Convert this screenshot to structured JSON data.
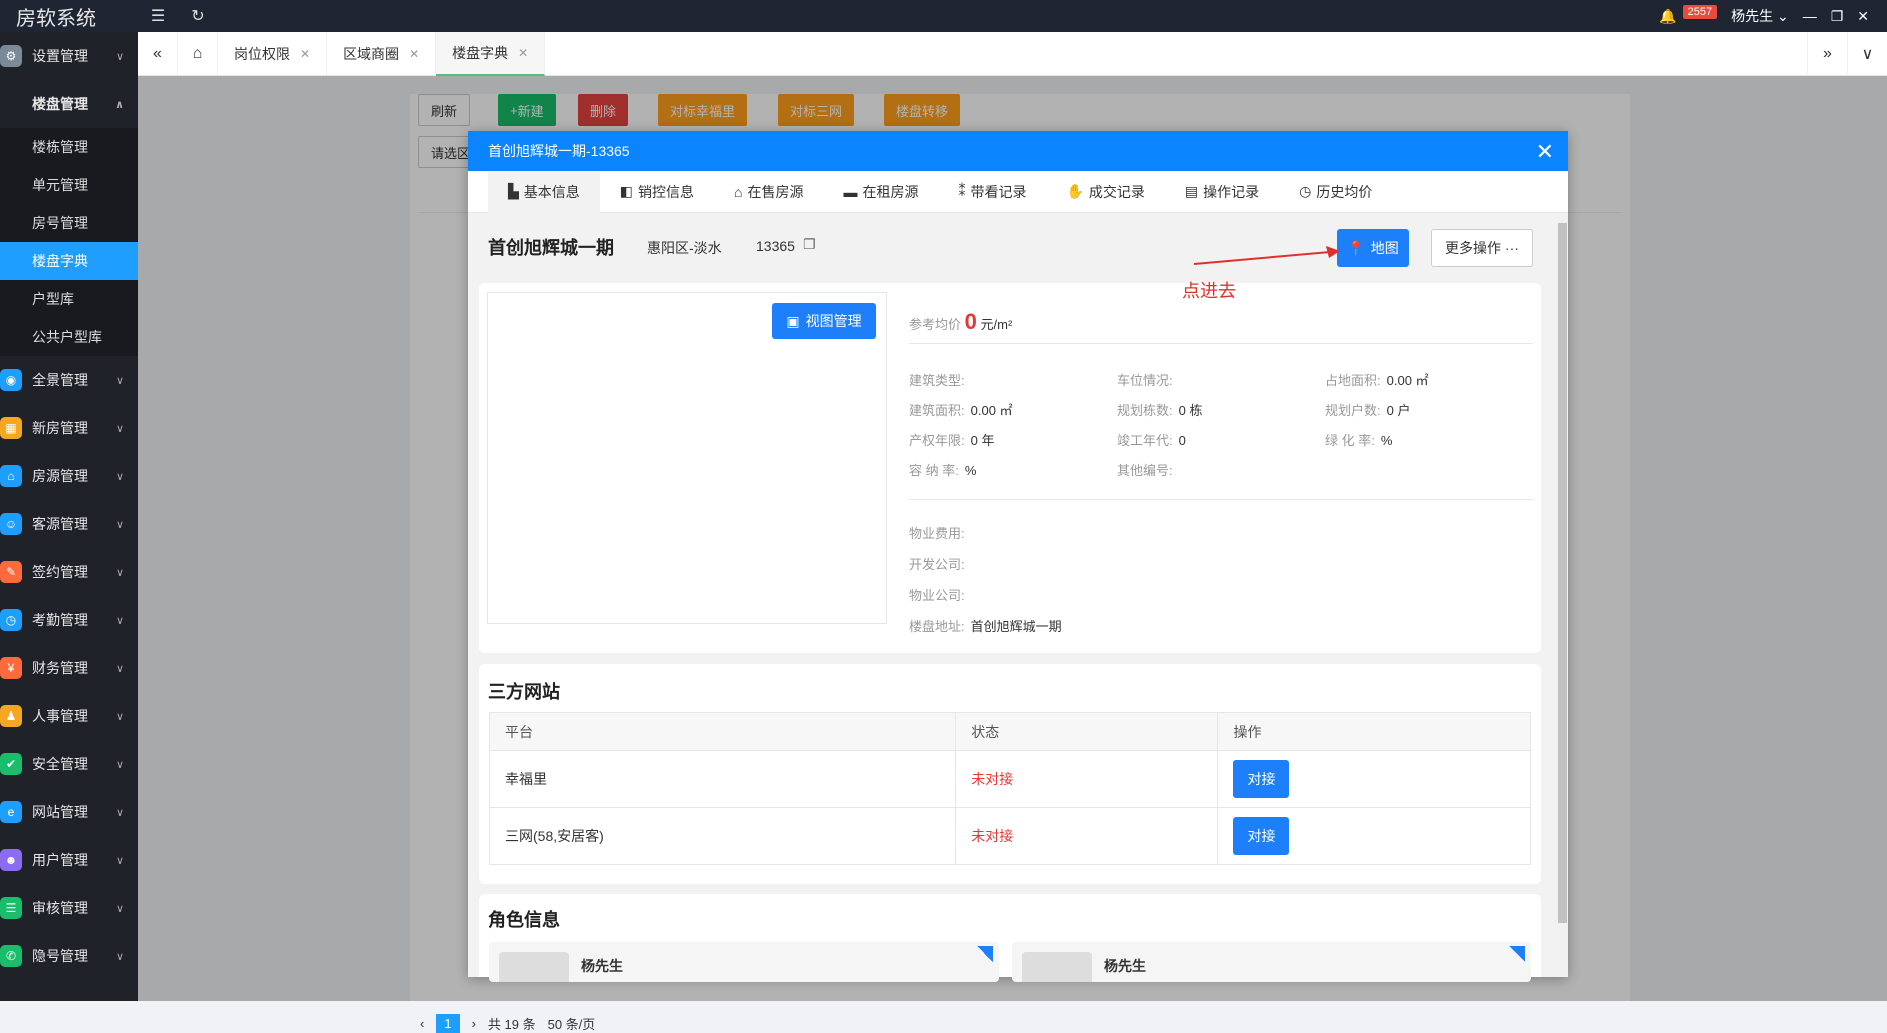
{
  "app": {
    "title": "房软系统"
  },
  "topbar": {
    "badge_count": "2557",
    "user": "杨先生"
  },
  "sidebar": {
    "items": [
      {
        "label": "设置管理",
        "color": "#7b8a99",
        "icon": "gear-icon"
      },
      {
        "label": "楼盘管理",
        "open": true
      },
      {
        "label": "全景管理",
        "color": "#1e9fff",
        "icon": "vr-icon"
      },
      {
        "label": "新房管理",
        "color": "#f5a623",
        "icon": "building-icon"
      },
      {
        "label": "房源管理",
        "color": "#1e9fff",
        "icon": "home-icon"
      },
      {
        "label": "客源管理",
        "color": "#1e9fff",
        "icon": "customer-icon"
      },
      {
        "label": "签约管理",
        "color": "#ff6a3d",
        "icon": "contract-icon"
      },
      {
        "label": "考勤管理",
        "color": "#1e9fff",
        "icon": "clock-icon"
      },
      {
        "label": "财务管理",
        "color": "#ff6a3d",
        "icon": "finance-icon"
      },
      {
        "label": "人事管理",
        "color": "#f5a623",
        "icon": "org-icon"
      },
      {
        "label": "安全管理",
        "color": "#19be6b",
        "icon": "shield-icon"
      },
      {
        "label": "网站管理",
        "color": "#1e9fff",
        "icon": "web-icon"
      },
      {
        "label": "用户管理",
        "color": "#8c6cf2",
        "icon": "user-icon"
      },
      {
        "label": "审核管理",
        "color": "#19be6b",
        "icon": "audit-icon"
      },
      {
        "label": "隐号管理",
        "color": "#19be6b",
        "icon": "phone-icon"
      }
    ],
    "sub_items": [
      "楼栋管理",
      "单元管理",
      "房号管理",
      "楼盘字典",
      "户型库",
      "公共户型库"
    ]
  },
  "tabs": [
    "岗位权限",
    "区域商圈",
    "楼盘字典"
  ],
  "toolbar": {
    "refresh": "刷新",
    "new": "新建",
    "delete": "删除",
    "map1": "对标幸福里",
    "map2": "对标三网",
    "transfer": "楼盘转移",
    "select_placeholder": "请选区"
  },
  "pagination": {
    "page": "1",
    "total": "共 19 条",
    "per_page": "50 条/页"
  },
  "modal": {
    "title": "首创旭辉城一期-13365",
    "tabs": [
      "基本信息",
      "销控信息",
      "在售房源",
      "在租房源",
      "带看记录",
      "成交记录",
      "操作记录",
      "历史均价"
    ],
    "estate_name": "首创旭辉城一期",
    "district": "惠阳区-淡水",
    "code": "13365",
    "map_button": "地图",
    "more_button": "更多操作 ···",
    "view_manage": "视图管理",
    "avg_price_label": "参考均价",
    "avg_price_value": "0",
    "avg_price_unit": "元/m²",
    "fields": {
      "build_type": {
        "label": "建筑类型:",
        "value": ""
      },
      "parking": {
        "label": "车位情况:",
        "value": ""
      },
      "land_area": {
        "label": "占地面积:",
        "value": "0.00 ㎡"
      },
      "build_area": {
        "label": "建筑面积:",
        "value": "0.00 ㎡"
      },
      "planned_buildings": {
        "label": "规划栋数:",
        "value": "0 栋"
      },
      "planned_households": {
        "label": "规划户数:",
        "value": "0 户"
      },
      "property_years": {
        "label": "产权年限:",
        "value": "0 年"
      },
      "completion_year": {
        "label": "竣工年代:",
        "value": "0"
      },
      "green_rate": {
        "label": "绿 化 率:",
        "value": "%"
      },
      "plot_ratio": {
        "label": "容 纳 率:",
        "value": "%"
      },
      "other_code": {
        "label": "其他编号:",
        "value": ""
      },
      "property_fee": {
        "label": "物业费用:",
        "value": ""
      },
      "developer": {
        "label": "开发公司:",
        "value": ""
      },
      "property_company": {
        "label": "物业公司:",
        "value": ""
      },
      "address": {
        "label": "楼盘地址:",
        "value": "首创旭辉城一期"
      }
    },
    "third_party": {
      "title": "三方网站",
      "headers": [
        "平台",
        "状态",
        "操作"
      ],
      "rows": [
        {
          "platform": "幸福里",
          "status": "未对接",
          "action": "对接"
        },
        {
          "platform": "三网(58,安居客)",
          "status": "未对接",
          "action": "对接"
        }
      ]
    },
    "roles": {
      "title": "角色信息",
      "people": [
        "杨先生",
        "杨先生"
      ]
    }
  },
  "annotation": "点进去"
}
